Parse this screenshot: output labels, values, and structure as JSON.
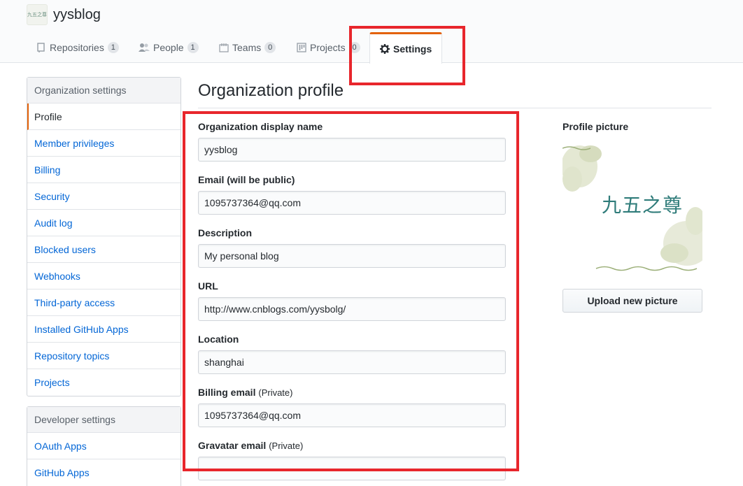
{
  "org": {
    "name": "yysblog",
    "avatar_text": "九五之尊"
  },
  "tabs": [
    {
      "label": "Repositories",
      "count": "1",
      "icon": "repo-icon"
    },
    {
      "label": "People",
      "count": "1",
      "icon": "people-icon"
    },
    {
      "label": "Teams",
      "count": "0",
      "icon": "teams-icon"
    },
    {
      "label": "Projects",
      "count": "0",
      "icon": "project-icon"
    },
    {
      "label": "Settings",
      "icon": "gear-icon",
      "selected": true
    }
  ],
  "sidebar": {
    "heading": "Organization settings",
    "items": [
      {
        "label": "Profile",
        "active": true
      },
      {
        "label": "Member privileges"
      },
      {
        "label": "Billing"
      },
      {
        "label": "Security"
      },
      {
        "label": "Audit log"
      },
      {
        "label": "Blocked users"
      },
      {
        "label": "Webhooks"
      },
      {
        "label": "Third-party access"
      },
      {
        "label": "Installed GitHub Apps"
      },
      {
        "label": "Repository topics"
      },
      {
        "label": "Projects"
      }
    ]
  },
  "dev_sidebar": {
    "heading": "Developer settings",
    "items": [
      {
        "label": "OAuth Apps"
      },
      {
        "label": "GitHub Apps"
      }
    ]
  },
  "main": {
    "title": "Organization profile",
    "fields": {
      "display_name": {
        "label": "Organization display name",
        "value": "yysblog"
      },
      "email": {
        "label": "Email (will be public)",
        "value": "1095737364@qq.com"
      },
      "description": {
        "label": "Description",
        "value": "My personal blog"
      },
      "url": {
        "label": "URL",
        "value": "http://www.cnblogs.com/yysbolg/"
      },
      "location": {
        "label": "Location",
        "value": "shanghai"
      },
      "billing_email": {
        "label": "Billing email",
        "note": "(Private)",
        "value": "1095737364@qq.com"
      },
      "gravatar_email": {
        "label": "Gravatar email",
        "note": "(Private)",
        "value": ""
      }
    }
  },
  "profile_picture": {
    "label": "Profile picture",
    "image_text": "九五之尊",
    "upload_label": "Upload new picture"
  },
  "colors": {
    "accent": "#e36209",
    "link": "#0366d6",
    "highlight": "#e8262c"
  }
}
